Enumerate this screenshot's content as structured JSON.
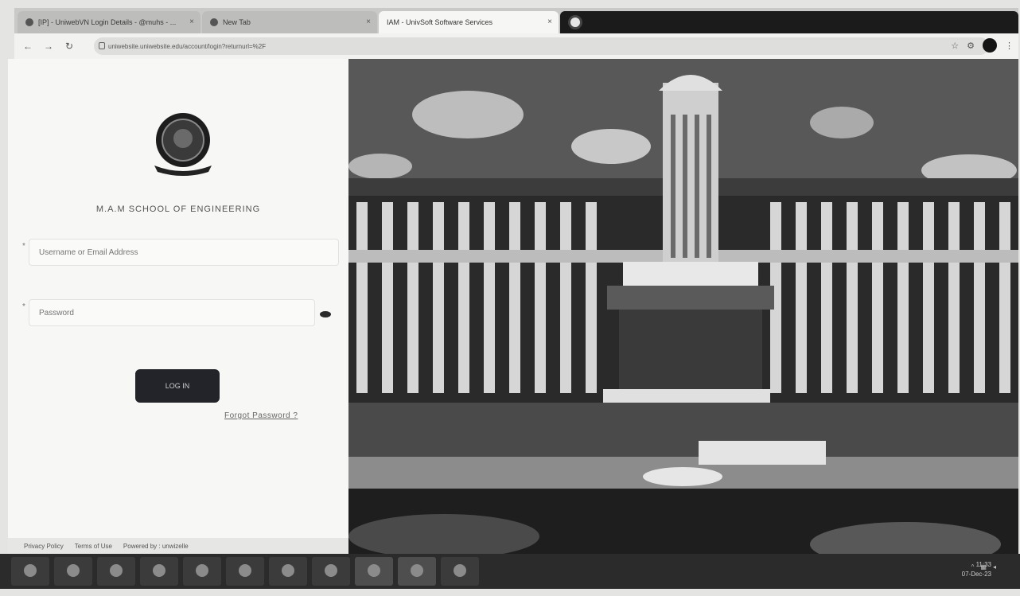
{
  "browser": {
    "tabs": [
      {
        "title": "[IP] - UniwebVN Login Details - @muhs - ...",
        "state": "inactive"
      },
      {
        "title": "New Tab",
        "state": "inactive"
      },
      {
        "title": "IAM - UnivSoft Software Services",
        "state": "active"
      },
      {
        "title": "",
        "state": "dark"
      }
    ],
    "tab_close_glyph": "×",
    "url": "uniwebsite.uniwebsite.edu/account/login?returnurl=%2F",
    "nav": {
      "back": "←",
      "forward": "→",
      "reload": "↻"
    }
  },
  "login": {
    "institution_name": "M.A.M SCHOOL OF ENGINEERING",
    "required_marker": "*",
    "username_placeholder": "Username or Email Address",
    "password_placeholder": "Password",
    "login_button": "LOG IN",
    "forgot_link": "Forgot Password ?"
  },
  "footer": {
    "links": [
      "Privacy Policy",
      "Terms of Use",
      "Powered by : unwizelle"
    ]
  },
  "taskbar": {
    "clock_time": "11:33",
    "clock_date": "07-Dec-23"
  },
  "colors": {
    "login_button_bg": "#22242a",
    "panel_bg": "#f7f7f6"
  }
}
